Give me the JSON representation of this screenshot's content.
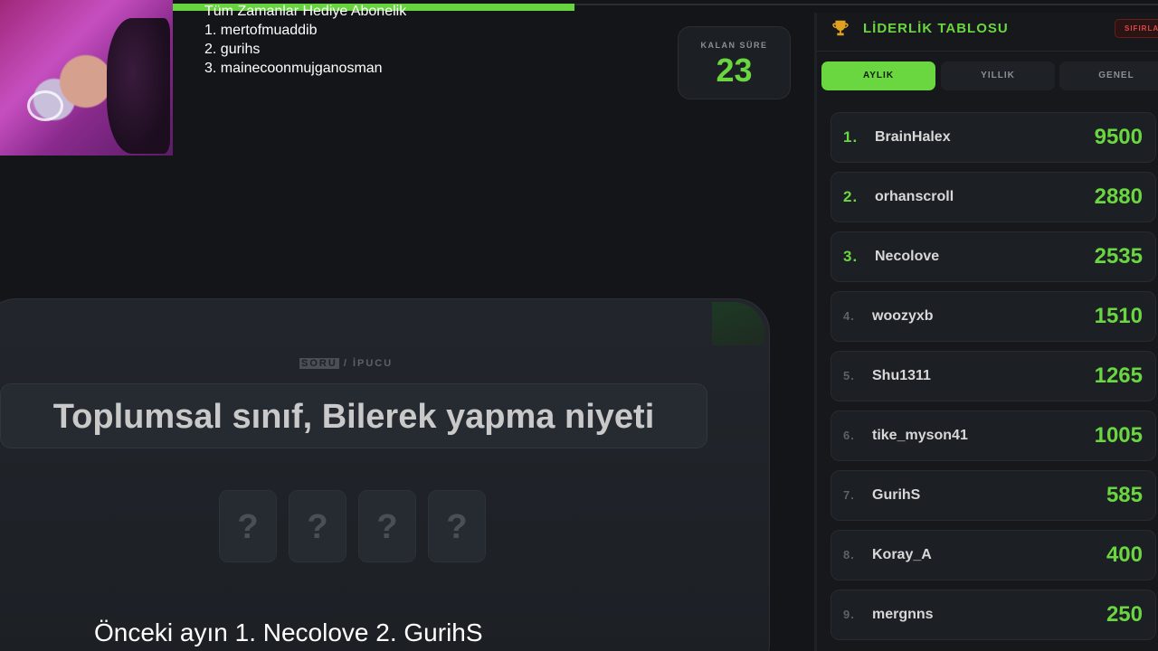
{
  "overlay": {
    "title": "Tüm Zamanlar Hediye  Abonelik",
    "entries": [
      "1. mertofmuaddib",
      "2. gurihs",
      "3. mainecoonmujganosman"
    ]
  },
  "timer": {
    "label": "KALAN SÜRE",
    "value": "23"
  },
  "question": {
    "tab_active": "SORU",
    "tab_sep": " / ",
    "tab_other": "İPUCU",
    "prompt": "Toplumsal sınıf, Bilerek yapma niyeti",
    "tiles": [
      "?",
      "?",
      "?",
      "?"
    ]
  },
  "caption": "Önceki ayın 1. Necolove 2. GurihS",
  "leaderboard": {
    "title": "LİDERLİK TABLOSU",
    "reset_label": "SIFIRLA",
    "tabs": [
      "AYLIK",
      "YILLIK",
      "GENEL"
    ],
    "active_tab": "AYLIK",
    "rows": [
      {
        "rank": "1.",
        "name": "BrainHalex",
        "score": "9500"
      },
      {
        "rank": "2.",
        "name": "orhanscroll",
        "score": "2880"
      },
      {
        "rank": "3.",
        "name": "Necolove",
        "score": "2535"
      },
      {
        "rank": "4.",
        "name": "woozyxb",
        "score": "1510"
      },
      {
        "rank": "5.",
        "name": "Shu1311",
        "score": "1265"
      },
      {
        "rank": "6.",
        "name": "tike_myson41",
        "score": "1005"
      },
      {
        "rank": "7.",
        "name": "GurihS",
        "score": "585"
      },
      {
        "rank": "8.",
        "name": "Koray_A",
        "score": "400"
      },
      {
        "rank": "9.",
        "name": "mergnns",
        "score": "250"
      }
    ]
  },
  "colors": {
    "accent": "#6ad640",
    "danger": "#e04848",
    "panel": "#1c1f24"
  },
  "icons": {
    "trophy": "trophy-icon"
  },
  "progress": {
    "fraction": 1.0
  }
}
